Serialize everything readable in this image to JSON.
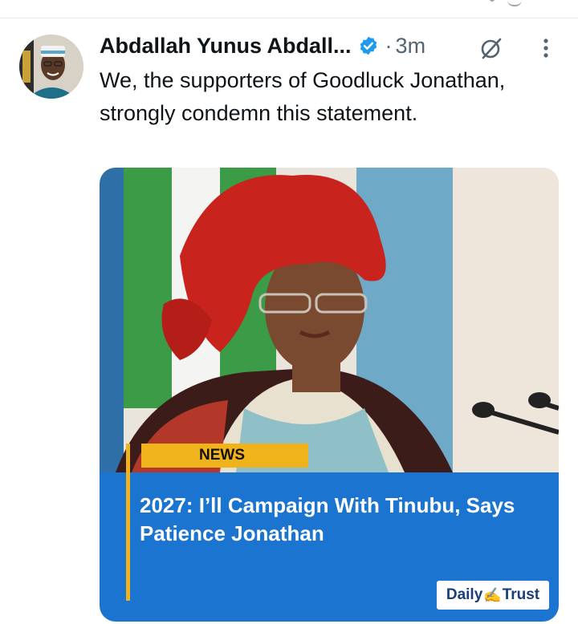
{
  "tweet": {
    "author": "Abdallah Yunus Abdall...",
    "separator": "·",
    "time": "3m",
    "text": "We, the supporters of Goodluck Jonathan, strongly condemn this statement."
  },
  "card": {
    "tag": "NEWS",
    "headline": "2027: I’ll Campaign With Tinubu, Says Patience Jonathan",
    "brand_left": "Daily",
    "brand_right": "Trust"
  },
  "colors": {
    "verified": "#1d9bf0",
    "news_band": "#1b74cf",
    "news_tag": "#f1b31c",
    "text_primary": "#0f1419",
    "text_secondary": "#536471"
  },
  "icons": [
    "verified-badge-icon",
    "grok-icon",
    "more-options-icon"
  ]
}
